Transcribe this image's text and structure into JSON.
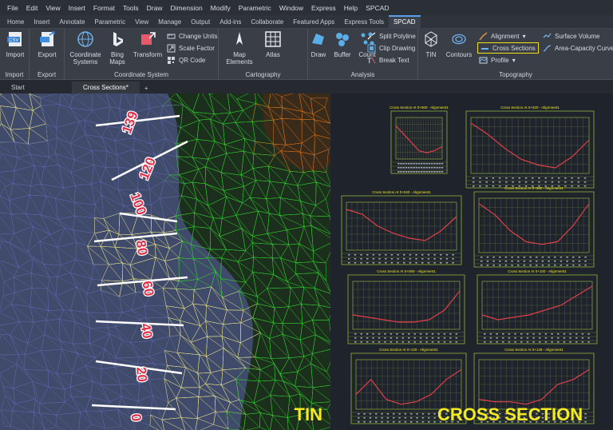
{
  "menu": [
    "File",
    "Edit",
    "View",
    "Insert",
    "Format",
    "Tools",
    "Draw",
    "Dimension",
    "Modify",
    "Parametric",
    "Window",
    "Express",
    "Help",
    "SPCAD"
  ],
  "tabs": [
    "Home",
    "Insert",
    "Annotate",
    "Parametric",
    "View",
    "Manage",
    "Output",
    "Add-ins",
    "Collaborate",
    "Featured Apps",
    "Express Tools",
    "SPCAD"
  ],
  "active_tab": "SPCAD",
  "ribbon": {
    "import": {
      "label": "Import",
      "title": "Import"
    },
    "export": {
      "label": "Export",
      "title": "Export"
    },
    "coordinate_systems": "Coordinate Systems",
    "bing_maps": "Bing Maps",
    "transform": "Transform",
    "change_units": "Change Units",
    "scale_factor": "Scale Factor",
    "qr_code": "QR Code",
    "coord_title": "Coordinate System",
    "map_elements": "Map Elements",
    "atlas": "Atlas",
    "cart_title": "Cartography",
    "draw": "Draw",
    "buffer": "Buffer",
    "count": "Count",
    "split_polyline": "Split Polyline",
    "clip_drawing": "Clip Drawing",
    "break_text": "Break Text",
    "analysis_title": "Analysis",
    "tin": "TIN",
    "contours": "Contours",
    "alignment": "Alignment",
    "cross_sections": "Cross  Sections",
    "profile": "Profile",
    "surface_volume": "Surface Volume",
    "area_capacity": "Area-Capacity Curve",
    "topo_title": "Topography"
  },
  "doc_tabs": {
    "start": "Start",
    "cross": "Cross Sections*",
    "plus": "+"
  },
  "stations": [
    "139",
    "120",
    "100",
    "80",
    "60",
    "40",
    "20",
    "0"
  ],
  "sections": [
    {
      "title": "Cross Section At 0+000 - Alignment1"
    },
    {
      "title": "Cross Section At 0+020 - Alignment1"
    },
    {
      "title": "Cross Section At 0+040 - Alignment1"
    },
    {
      "title": "Cross Section At 0+060 - Alignment1"
    },
    {
      "title": "Cross Section At 0+080 - Alignment1"
    },
    {
      "title": "Cross Section At 0+100 - Alignment1"
    },
    {
      "title": "Cross Section At 0+120 - Alignment1"
    },
    {
      "title": "Cross Section At 0+139 - Alignment1"
    }
  ],
  "captions": {
    "tin": "TIN",
    "cross": "CROSS SECTION"
  },
  "colors": {
    "accent": "#f4ea22",
    "profile": "#e0404a",
    "grid": "#8fb43c",
    "station": "#e0304a"
  }
}
